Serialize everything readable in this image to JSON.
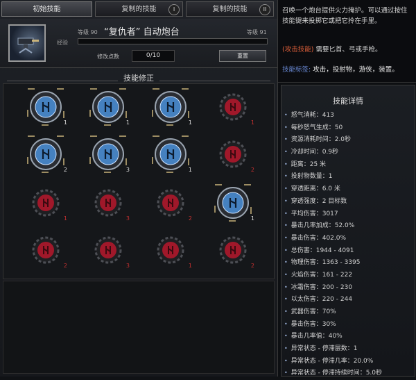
{
  "tabs": [
    {
      "label": "初始技能",
      "badge": ""
    },
    {
      "label": "复制的技能",
      "badge": "I"
    },
    {
      "label": "复制的技能",
      "badge": "II"
    }
  ],
  "skill": {
    "title": "“复仇者” 自动炮台",
    "level_left": "等级 90",
    "level_right": "等级 91",
    "xp_label": "经验",
    "points_label": "修改点数",
    "points_value": "0/10",
    "reset_label": "重置"
  },
  "modifiers": {
    "title": "技能修正",
    "slots": [
      {
        "state": "active",
        "count": "1"
      },
      {
        "state": "active",
        "count": "1"
      },
      {
        "state": "active",
        "count": "1"
      },
      {
        "state": "locked",
        "count": "1"
      },
      {
        "state": "active",
        "count": "2"
      },
      {
        "state": "active",
        "count": "3"
      },
      {
        "state": "active",
        "count": "1"
      },
      {
        "state": "locked",
        "count": "2"
      },
      {
        "state": "locked",
        "count": "1"
      },
      {
        "state": "locked",
        "count": "3"
      },
      {
        "state": "locked",
        "count": "2"
      },
      {
        "state": "active",
        "count": "1"
      },
      {
        "state": "locked",
        "count": "2"
      },
      {
        "state": "locked",
        "count": "3"
      },
      {
        "state": "locked",
        "count": "1"
      },
      {
        "state": "locked",
        "count": "2"
      }
    ]
  },
  "description": {
    "text": "召唤一个炮台提供火力掩护。可以通过按住技能键来投掷它或把它拎在手里。",
    "req_tag": "(攻击技能)",
    "req_text": " 需要匕首、弓或手枪。",
    "tag_label": "技能标签:",
    "tags": " 攻击，投射物，游侠，装置。"
  },
  "details": {
    "title": "技能详情",
    "stats": [
      "怒气消耗：413",
      "每秒怒气生成：50",
      "资源消耗时间：2.0秒",
      "冷却时间：0.9秒",
      "距离：25 米",
      "投射物数量：1",
      "穿透距离：6.0 米",
      "穿透强度：2 目标数",
      "平均伤害：3017",
      "暴击几率加成：52.0%",
      "暴击伤害：402.0%",
      "总伤害：1944 - 4091",
      "物理伤害：1363 - 3395",
      "火焰伤害：161 - 222",
      "冰霜伤害：200 - 230",
      "以太伤害：220 - 244",
      "武器伤害：70%",
      "暴击伤害：30%",
      "暴击几率值：40%",
      "异常状态 - 停滞层数：1",
      "异常状态 - 停滞几率：20.0%",
      "异常状态 - 停滞持续时间：5.0秒"
    ]
  },
  "colors": {
    "active_rune": "#4a90d9",
    "locked_rune": "#a0182a",
    "gold_frame": "#c9b37a"
  }
}
